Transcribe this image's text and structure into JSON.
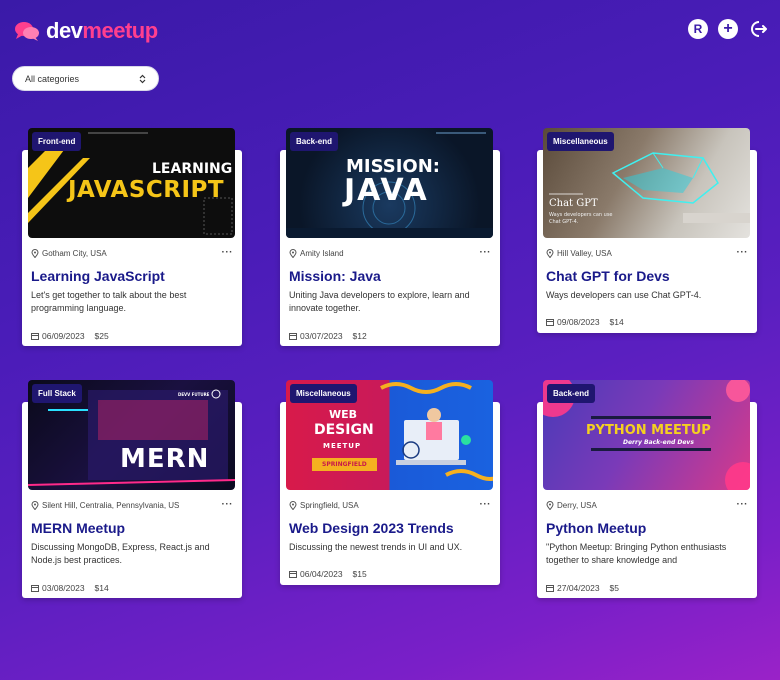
{
  "brand": {
    "part1": "dev",
    "part2": "meetup"
  },
  "header": {
    "r_label": "R",
    "plus_label": "+"
  },
  "filter": {
    "value": "All categories"
  },
  "events": [
    {
      "category": "Front-end",
      "location": "Gotham City, USA",
      "title": "Learning JavaScript",
      "description": "Let's get together to talk about the best programming language.",
      "date": "06/09/2023",
      "price": "$25",
      "image": {
        "line1": "LEARNING",
        "line2": "JAVASCRIPT"
      }
    },
    {
      "category": "Back-end",
      "location": "Amity Island",
      "title": "Mission: Java",
      "description": "Uniting Java developers to explore, learn and innovate together.",
      "date": "03/07/2023",
      "price": "$12",
      "image": {
        "line1": "MISSION:",
        "line2": "JAVA"
      }
    },
    {
      "category": "Miscellaneous",
      "location": "Hill Valley, USA",
      "title": "Chat GPT for Devs",
      "description": "Ways developers can use Chat GPT-4.",
      "date": "09/08/2023",
      "price": "$14",
      "image": {
        "line1": "Chat GPT",
        "line2": "Ways developers can use Chat GPT-4."
      }
    },
    {
      "category": "Full Stack",
      "location": "Silent Hill, Centralia, Pennsylvania, US",
      "title": "MERN Meetup",
      "description": "Discussing MongoDB, Express, React.js and Node.js best practices.",
      "date": "03/08/2023",
      "price": "$14",
      "image": {
        "line1": "MERN",
        "line2": "DEVV FUTURE"
      }
    },
    {
      "category": "Miscellaneous",
      "location": "Springfield, USA",
      "title": "Web Design 2023 Trends",
      "description": "Discussing the newest trends in UI and UX.",
      "date": "06/04/2023",
      "price": "$15",
      "image": {
        "line1": "WEB",
        "line2": "DESIGN",
        "line3": "MEETUP",
        "line4": "SPRINGFIELD"
      }
    },
    {
      "category": "Back-end",
      "location": "Derry, USA",
      "title": "Python Meetup",
      "description": "\"Python Meetup: Bringing Python enthusiasts together to share knowledge and",
      "date": "27/04/2023",
      "price": "$5",
      "image": {
        "line1": "PYTHON MEETUP",
        "line2": "Derry Back-end Devs"
      }
    }
  ]
}
